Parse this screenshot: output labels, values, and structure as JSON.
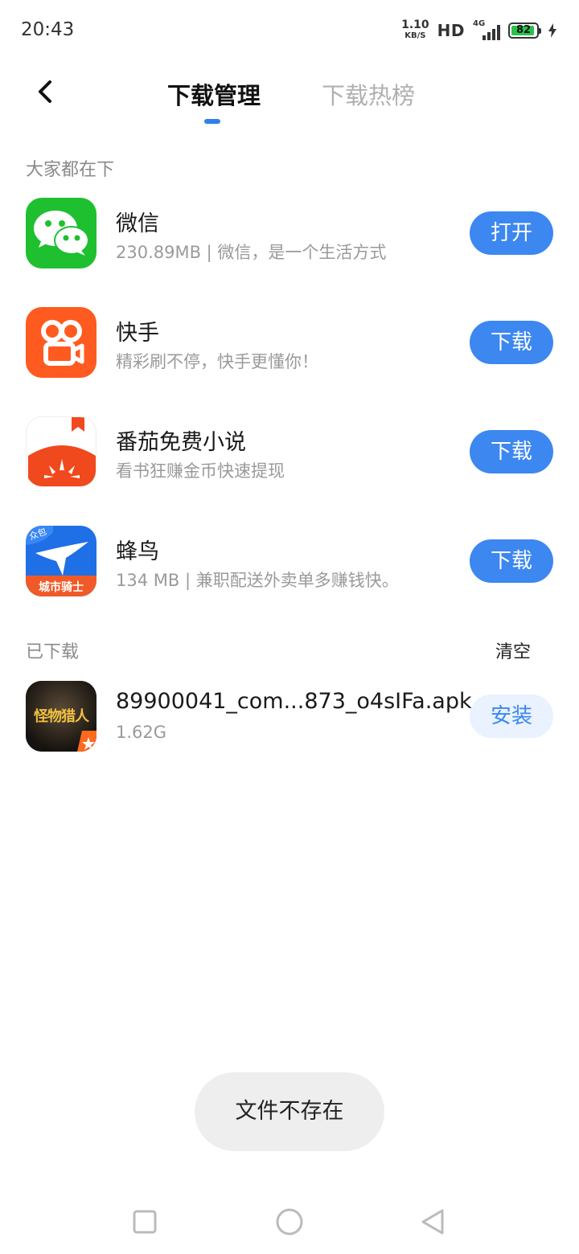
{
  "status": {
    "time": "20:43",
    "speed_value": "1.10",
    "speed_unit": "KB/S",
    "hd": "HD",
    "network": "4G",
    "battery": "82"
  },
  "header": {
    "tabs": [
      {
        "label": "下载管理",
        "active": true
      },
      {
        "label": "下载热榜",
        "active": false
      }
    ],
    "accent": "#2f80ed"
  },
  "recommend": {
    "title": "大家都在下",
    "apps": [
      {
        "name": "微信",
        "desc": "230.89MB | 微信，是一个生活方式",
        "button": "打开",
        "icon": "wechat-icon"
      },
      {
        "name": "快手",
        "desc": "精彩刷不停，快手更懂你！",
        "button": "下载",
        "icon": "kuaishou-icon"
      },
      {
        "name": "番茄免费小说",
        "desc": "看书狂赚金币快速提现",
        "button": "下载",
        "icon": "fanqie-novel-icon"
      },
      {
        "name": "蜂鸟",
        "desc": "134 MB | 兼职配送外卖单多赚钱快。",
        "button": "下载",
        "icon": "fengniao-icon",
        "badge": "众包",
        "banner": "城市骑士"
      }
    ]
  },
  "downloaded": {
    "title": "已下载",
    "clear_label": "清空",
    "items": [
      {
        "name": "89900041_com...873_o4sIFa.apk",
        "size": "1.62G",
        "button": "安装",
        "icon": "game-icon",
        "icon_text": "怪物猎人"
      }
    ]
  },
  "toast": "文件不存在",
  "colors": {
    "button_blue": "#3c87f0",
    "wechat_green": "#1fc02f",
    "kuaishou_orange": "#ff5a1f",
    "fanqie_red": "#f0491d",
    "fengniao_blue": "#1f6fe6"
  }
}
